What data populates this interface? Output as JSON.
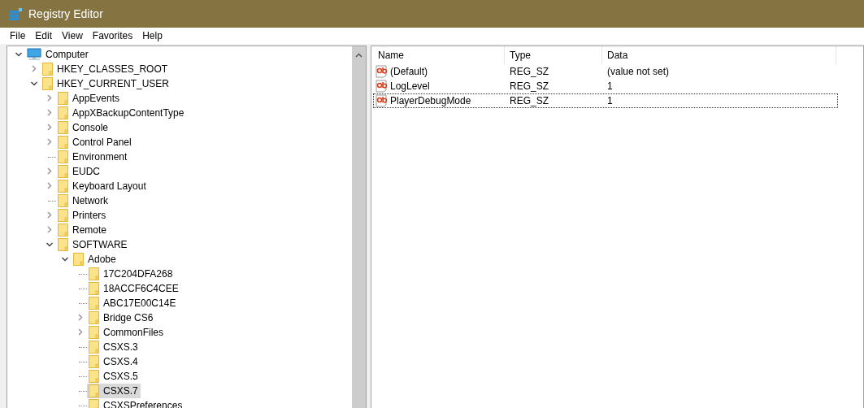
{
  "window": {
    "title": "Registry Editor"
  },
  "menu": [
    "File",
    "Edit",
    "View",
    "Favorites",
    "Help"
  ],
  "tree": {
    "items": [
      {
        "label": "Computer",
        "kind": "computer",
        "expandable": true,
        "expanded": true,
        "selected": false,
        "children": [
          {
            "label": "HKEY_CLASSES_ROOT",
            "kind": "folder",
            "expandable": true,
            "expanded": false,
            "selected": false
          },
          {
            "label": "HKEY_CURRENT_USER",
            "kind": "folder",
            "expandable": true,
            "expanded": true,
            "selected": false,
            "children": [
              {
                "label": "AppEvents",
                "kind": "folder",
                "expandable": true,
                "expanded": false,
                "selected": false
              },
              {
                "label": "AppXBackupContentType",
                "kind": "folder",
                "expandable": true,
                "expanded": false,
                "selected": false
              },
              {
                "label": "Console",
                "kind": "folder",
                "expandable": true,
                "expanded": false,
                "selected": false
              },
              {
                "label": "Control Panel",
                "kind": "folder",
                "expandable": true,
                "expanded": false,
                "selected": false
              },
              {
                "label": "Environment",
                "kind": "folder",
                "expandable": false,
                "selected": false
              },
              {
                "label": "EUDC",
                "kind": "folder",
                "expandable": true,
                "expanded": false,
                "selected": false
              },
              {
                "label": "Keyboard Layout",
                "kind": "folder",
                "expandable": true,
                "expanded": false,
                "selected": false
              },
              {
                "label": "Network",
                "kind": "folder",
                "expandable": false,
                "selected": false
              },
              {
                "label": "Printers",
                "kind": "folder",
                "expandable": true,
                "expanded": false,
                "selected": false
              },
              {
                "label": "Remote",
                "kind": "folder",
                "expandable": true,
                "expanded": false,
                "selected": false
              },
              {
                "label": "SOFTWARE",
                "kind": "folder",
                "expandable": true,
                "expanded": true,
                "selected": false,
                "children": [
                  {
                    "label": "Adobe",
                    "kind": "folder",
                    "expandable": true,
                    "expanded": true,
                    "selected": false,
                    "children": [
                      {
                        "label": "17C204DFA268",
                        "kind": "folder",
                        "expandable": false,
                        "selected": false
                      },
                      {
                        "label": "18ACCF6C4CEE",
                        "kind": "folder",
                        "expandable": false,
                        "selected": false
                      },
                      {
                        "label": "ABC17E00C14E",
                        "kind": "folder",
                        "expandable": false,
                        "selected": false
                      },
                      {
                        "label": "Bridge CS6",
                        "kind": "folder",
                        "expandable": true,
                        "expanded": false,
                        "selected": false
                      },
                      {
                        "label": "CommonFiles",
                        "kind": "folder",
                        "expandable": true,
                        "expanded": false,
                        "selected": false
                      },
                      {
                        "label": "CSXS.3",
                        "kind": "folder",
                        "expandable": false,
                        "selected": false
                      },
                      {
                        "label": "CSXS.4",
                        "kind": "folder",
                        "expandable": false,
                        "selected": false
                      },
                      {
                        "label": "CSXS.5",
                        "kind": "folder",
                        "expandable": false,
                        "selected": false
                      },
                      {
                        "label": "CSXS.7",
                        "kind": "folder",
                        "expandable": false,
                        "selected": true
                      },
                      {
                        "label": "CSXSPreferences",
                        "kind": "folder",
                        "expandable": false,
                        "selected": false
                      }
                    ]
                  }
                ]
              }
            ]
          }
        ]
      }
    ]
  },
  "list": {
    "columns": [
      "Name",
      "Type",
      "Data"
    ],
    "rows": [
      {
        "name": "(Default)",
        "type": "REG_SZ",
        "data": "(value not set)",
        "focused": false
      },
      {
        "name": "LogLevel",
        "type": "REG_SZ",
        "data": "1",
        "focused": false
      },
      {
        "name": "PlayerDebugMode",
        "type": "REG_SZ",
        "data": "1",
        "focused": true
      }
    ]
  }
}
